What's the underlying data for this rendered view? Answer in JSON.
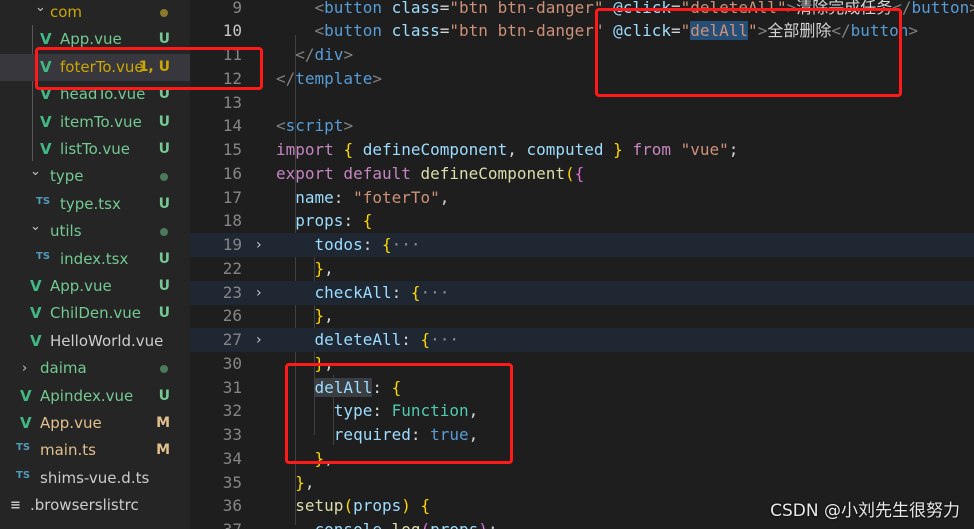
{
  "explorer": {
    "items": [
      {
        "label": "com",
        "kind": "folder",
        "open": true,
        "color": "#cca700",
        "dot": "#8c7a2b"
      },
      {
        "label": "App.vue",
        "kind": "vue",
        "badge": "U",
        "color": "#73c991"
      },
      {
        "label": "foterTo.vue",
        "kind": "vue",
        "badge": "1, U",
        "color": "#cca700",
        "selected": true
      },
      {
        "label": "headTo.vue",
        "kind": "vue",
        "badge": "U",
        "color": "#73c991"
      },
      {
        "label": "itemTo.vue",
        "kind": "vue",
        "badge": "U",
        "color": "#73c991"
      },
      {
        "label": "listTo.vue",
        "kind": "vue",
        "badge": "U",
        "color": "#73c991"
      },
      {
        "label": "type",
        "kind": "folder",
        "open": true,
        "color": "#73c991",
        "dot": "#4d7a5a"
      },
      {
        "label": "type.tsx",
        "kind": "ts",
        "badge": "U",
        "color": "#73c991"
      },
      {
        "label": "utils",
        "kind": "folder",
        "open": true,
        "color": "#73c991",
        "dot": "#4d7a5a"
      },
      {
        "label": "index.tsx",
        "kind": "ts",
        "badge": "U",
        "color": "#73c991"
      },
      {
        "label": "App.vue",
        "kind": "vue",
        "badge": "U",
        "color": "#73c991"
      },
      {
        "label": "ChilDen.vue",
        "kind": "vue",
        "badge": "U",
        "color": "#73c991"
      },
      {
        "label": "HelloWorld.vue",
        "kind": "vue",
        "color": "#cccccc"
      },
      {
        "label": "daima",
        "kind": "folder",
        "open": false,
        "color": "#73c991",
        "dot": "#4d7a5a"
      },
      {
        "label": "Apindex.vue",
        "kind": "vue",
        "badge": "U",
        "color": "#73c991"
      },
      {
        "label": "App.vue",
        "kind": "vue",
        "badge": "M",
        "color": "#e2c08d"
      },
      {
        "label": "main.ts",
        "kind": "ts",
        "badge": "M",
        "color": "#e2c08d"
      },
      {
        "label": "shims-vue.d.ts",
        "kind": "ts",
        "color": "#cccccc"
      },
      {
        "label": ".browserslistrc",
        "kind": "config",
        "color": "#cccccc"
      }
    ]
  },
  "editor": {
    "lines": [
      {
        "n": "9",
        "tokens": [
          [
            "    ",
            "plain"
          ],
          [
            "<",
            "tag"
          ],
          [
            "button",
            "name"
          ],
          [
            " class",
            "attr"
          ],
          [
            "=",
            "plain"
          ],
          [
            "\"btn btn-danger\"",
            "str"
          ],
          [
            " @click",
            "attr"
          ],
          [
            "=",
            "plain"
          ],
          [
            "\"deleteAll\"",
            "str"
          ],
          [
            ">",
            "tag"
          ],
          [
            "清除完成任务",
            "plain"
          ],
          [
            "</",
            "tag"
          ],
          [
            "button",
            "name"
          ],
          [
            ">",
            "tag"
          ]
        ]
      },
      {
        "n": "10",
        "current": true,
        "tokens": [
          [
            "    ",
            "plain"
          ],
          [
            "<",
            "tag"
          ],
          [
            "button",
            "name"
          ],
          [
            " class",
            "attr"
          ],
          [
            "=",
            "plain"
          ],
          [
            "\"btn btn-danger\"",
            "str"
          ],
          [
            " @click",
            "attr"
          ],
          [
            "=",
            "plain"
          ],
          [
            "\"",
            "str"
          ],
          [
            "delAll",
            "str",
            "sel"
          ],
          [
            "\"",
            "str"
          ],
          [
            ">",
            "tag"
          ],
          [
            "全部删除",
            "plain"
          ],
          [
            "</",
            "tag"
          ],
          [
            "button",
            "name"
          ],
          [
            ">",
            "tag"
          ]
        ]
      },
      {
        "n": "11",
        "tokens": [
          [
            "  ",
            "plain"
          ],
          [
            "</",
            "tag"
          ],
          [
            "div",
            "name"
          ],
          [
            ">",
            "tag"
          ]
        ]
      },
      {
        "n": "12",
        "tokens": [
          [
            "</",
            "tag"
          ],
          [
            "template",
            "name"
          ],
          [
            ">",
            "tag"
          ]
        ]
      },
      {
        "n": "13",
        "tokens": []
      },
      {
        "n": "14",
        "tokens": [
          [
            "<",
            "tag"
          ],
          [
            "script",
            "name"
          ],
          [
            ">",
            "tag"
          ]
        ]
      },
      {
        "n": "15",
        "tokens": [
          [
            "import",
            "kw"
          ],
          [
            " ",
            "plain"
          ],
          [
            "{",
            "br"
          ],
          [
            " defineComponent",
            "var"
          ],
          [
            ", ",
            "plain"
          ],
          [
            "computed",
            "var"
          ],
          [
            " ",
            "plain"
          ],
          [
            "}",
            "br"
          ],
          [
            " from",
            "kw"
          ],
          [
            " ",
            "plain"
          ],
          [
            "\"vue\"",
            "str"
          ],
          [
            ";",
            "plain"
          ]
        ]
      },
      {
        "n": "16",
        "tokens": [
          [
            "export",
            "kw"
          ],
          [
            " default",
            "kw"
          ],
          [
            " defineComponent",
            "fn"
          ],
          [
            "(",
            "br"
          ],
          [
            "{",
            "br2"
          ]
        ]
      },
      {
        "n": "17",
        "tokens": [
          [
            "  name",
            "var"
          ],
          [
            ": ",
            "plain"
          ],
          [
            "\"foterTo\"",
            "str"
          ],
          [
            ",",
            "plain"
          ]
        ]
      },
      {
        "n": "18",
        "tokens": [
          [
            "  props",
            "var"
          ],
          [
            ": ",
            "plain"
          ],
          [
            "{",
            "br"
          ]
        ]
      },
      {
        "n": "19",
        "folded": true,
        "tokens": [
          [
            "    todos",
            "var"
          ],
          [
            ": ",
            "plain"
          ],
          [
            "{",
            "br"
          ],
          [
            "···",
            "fold"
          ]
        ]
      },
      {
        "n": "22",
        "tokens": [
          [
            "    ",
            "plain"
          ],
          [
            "}",
            "br"
          ],
          [
            ",",
            "plain"
          ]
        ]
      },
      {
        "n": "23",
        "folded": true,
        "tokens": [
          [
            "    checkAll",
            "var"
          ],
          [
            ": ",
            "plain"
          ],
          [
            "{",
            "br"
          ],
          [
            "···",
            "fold"
          ]
        ]
      },
      {
        "n": "26",
        "tokens": [
          [
            "    ",
            "plain"
          ],
          [
            "}",
            "br"
          ],
          [
            ",",
            "plain"
          ]
        ]
      },
      {
        "n": "27",
        "folded": true,
        "tokens": [
          [
            "    deleteAll",
            "var"
          ],
          [
            ": ",
            "plain"
          ],
          [
            "{",
            "br"
          ],
          [
            "···",
            "fold"
          ]
        ]
      },
      {
        "n": "30",
        "tokens": [
          [
            "    ",
            "plain"
          ],
          [
            "}",
            "br"
          ],
          [
            ",",
            "plain"
          ]
        ]
      },
      {
        "n": "31",
        "tokens": [
          [
            "    ",
            "plain"
          ],
          [
            "delAll",
            "var",
            "occ"
          ],
          [
            ": ",
            "plain"
          ],
          [
            "{",
            "br"
          ]
        ]
      },
      {
        "n": "32",
        "tokens": [
          [
            "      type",
            "var"
          ],
          [
            ": ",
            "plain"
          ],
          [
            "Function",
            "type"
          ],
          [
            ",",
            "plain"
          ]
        ]
      },
      {
        "n": "33",
        "tokens": [
          [
            "      required",
            "var"
          ],
          [
            ": ",
            "plain"
          ],
          [
            "true",
            "bool"
          ],
          [
            ",",
            "plain"
          ]
        ]
      },
      {
        "n": "34",
        "tokens": [
          [
            "    ",
            "plain"
          ],
          [
            "}",
            "br"
          ],
          [
            ",",
            "plain"
          ]
        ]
      },
      {
        "n": "35",
        "tokens": [
          [
            "  ",
            "plain"
          ],
          [
            "}",
            "br"
          ],
          [
            ",",
            "plain"
          ]
        ]
      },
      {
        "n": "36",
        "tokens": [
          [
            "  setup",
            "fn"
          ],
          [
            "(",
            "br"
          ],
          [
            "props",
            "var"
          ],
          [
            ") ",
            "br"
          ],
          [
            "{",
            "br"
          ]
        ]
      },
      {
        "n": "37",
        "tokens": [
          [
            "    console",
            "var"
          ],
          [
            ".",
            "plain"
          ],
          [
            "log",
            "fn"
          ],
          [
            "(",
            "br2"
          ],
          [
            "props",
            "var"
          ],
          [
            ")",
            "br2"
          ],
          [
            ";",
            "plain"
          ]
        ]
      }
    ]
  },
  "watermark": "CSDN @小刘先生很努力",
  "colors": {
    "annotation": "#ff1a1a",
    "selection": "#264f78",
    "editor_bg": "#1e1e1e",
    "sidebar_bg": "#252526"
  }
}
